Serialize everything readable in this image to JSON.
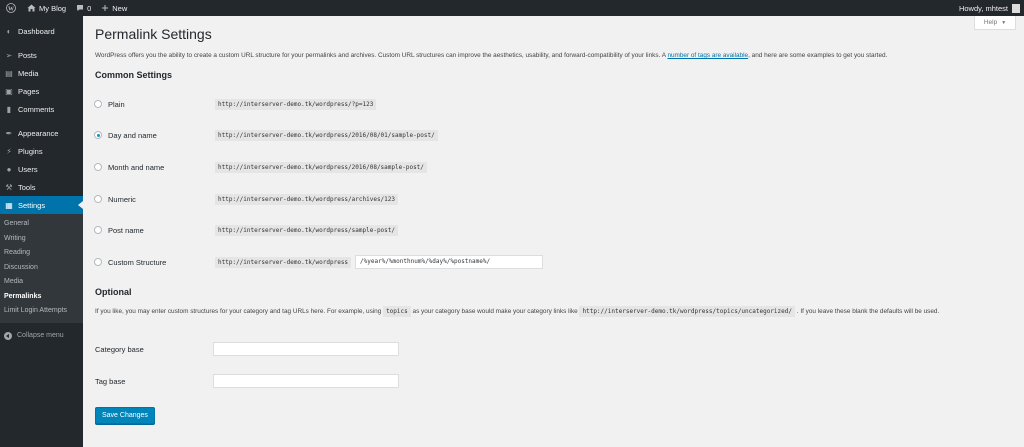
{
  "adminbar": {
    "site_name": "My Blog",
    "comments_count": "0",
    "new_label": "New",
    "howdy": "Howdy, mhtest"
  },
  "sidebar": {
    "items": [
      {
        "label": "Dashboard",
        "icon": "dashboard-icon"
      },
      {
        "label": "Posts",
        "icon": "pin-icon"
      },
      {
        "label": "Media",
        "icon": "media-icon"
      },
      {
        "label": "Pages",
        "icon": "pages-icon"
      },
      {
        "label": "Comments",
        "icon": "comment-icon"
      },
      {
        "label": "Appearance",
        "icon": "brush-icon"
      },
      {
        "label": "Plugins",
        "icon": "plugin-icon"
      },
      {
        "label": "Users",
        "icon": "users-icon"
      },
      {
        "label": "Tools",
        "icon": "wrench-icon"
      },
      {
        "label": "Settings",
        "icon": "settings-icon"
      }
    ],
    "submenu": [
      "General",
      "Writing",
      "Reading",
      "Discussion",
      "Media",
      "Permalinks",
      "Limit Login Attempts"
    ],
    "collapse_label": "Collapse menu"
  },
  "help_label": "Help",
  "page_title": "Permalink Settings",
  "intro": {
    "text_before": "WordPress offers you the ability to create a custom URL structure for your permalinks and archives. Custom URL structures can improve the aesthetics, usability, and forward-compatibility of your links. A ",
    "link": "number of tags are available",
    "text_after": ", and here are some examples to get you started."
  },
  "common_settings": {
    "heading": "Common Settings",
    "options": [
      {
        "label": "Plain",
        "example": "http://interserver-demo.tk/wordpress/?p=123",
        "checked": false
      },
      {
        "label": "Day and name",
        "example": "http://interserver-demo.tk/wordpress/2016/08/01/sample-post/",
        "checked": true
      },
      {
        "label": "Month and name",
        "example": "http://interserver-demo.tk/wordpress/2016/08/sample-post/",
        "checked": false
      },
      {
        "label": "Numeric",
        "example": "http://interserver-demo.tk/wordpress/archives/123",
        "checked": false
      },
      {
        "label": "Post name",
        "example": "http://interserver-demo.tk/wordpress/sample-post/",
        "checked": false
      },
      {
        "label": "Custom Structure",
        "example": "http://interserver-demo.tk/wordpress",
        "value": "/%year%/%monthnum%/%day%/%postname%/",
        "checked": false
      }
    ]
  },
  "optional": {
    "heading": "Optional",
    "desc_1": "If you like, you may enter custom structures for your category and tag URLs here. For example, using ",
    "code_1": "topics",
    "desc_2": " as your category base would make your category links like ",
    "code_2": "http://interserver-demo.tk/wordpress/topics/uncategorized/",
    "desc_3": " . If you leave these blank the defaults will be used.",
    "category_base_label": "Category base",
    "category_base_value": "",
    "tag_base_label": "Tag base",
    "tag_base_value": ""
  },
  "save_label": "Save Changes"
}
